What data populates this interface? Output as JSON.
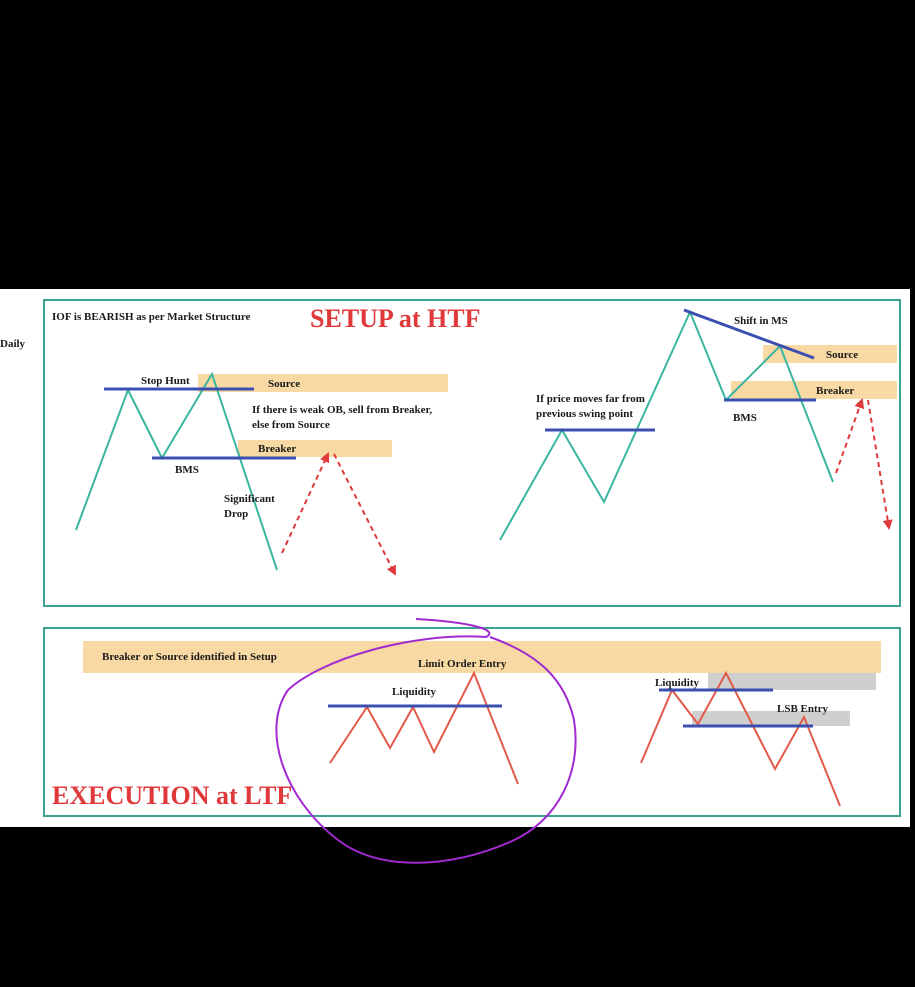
{
  "side_label": "Daily",
  "setup": {
    "header": "IOF is BEARISH as per Market Structure",
    "title": "SETUP at HTF",
    "left": {
      "stop_hunt": "Stop Hunt",
      "source": "Source",
      "note_line1": "If there is weak OB, sell from Breaker,",
      "note_line2": "else from Source",
      "breaker": "Breaker",
      "bms": "BMS",
      "drop_line1": "Significant",
      "drop_line2": "Drop"
    },
    "right": {
      "shift": "Shift in MS",
      "source": "Source",
      "breaker": "Breaker",
      "bms": "BMS",
      "note_line1": "If price moves far from",
      "note_line2": "previous swing point"
    }
  },
  "execution": {
    "zone_label": "Breaker or Source identified in Setup",
    "limit_entry": "Limit Order Entry",
    "liquidity": "Liquidity",
    "title": "EXECUTION at LTF",
    "right_liquidity": "Liquidity",
    "lsb_entry": "LSB Entry"
  },
  "colors": {
    "frame": "#3aa392",
    "zone": "#f8d9a3",
    "gray_zone": "#cfcfcf",
    "level": "#3b4fb0",
    "htf_price": "#3ab6a0",
    "ltf_price": "#e25a4a",
    "projection": "#e0393b",
    "title": "#e0393b",
    "annotation": "#a12bd0"
  }
}
